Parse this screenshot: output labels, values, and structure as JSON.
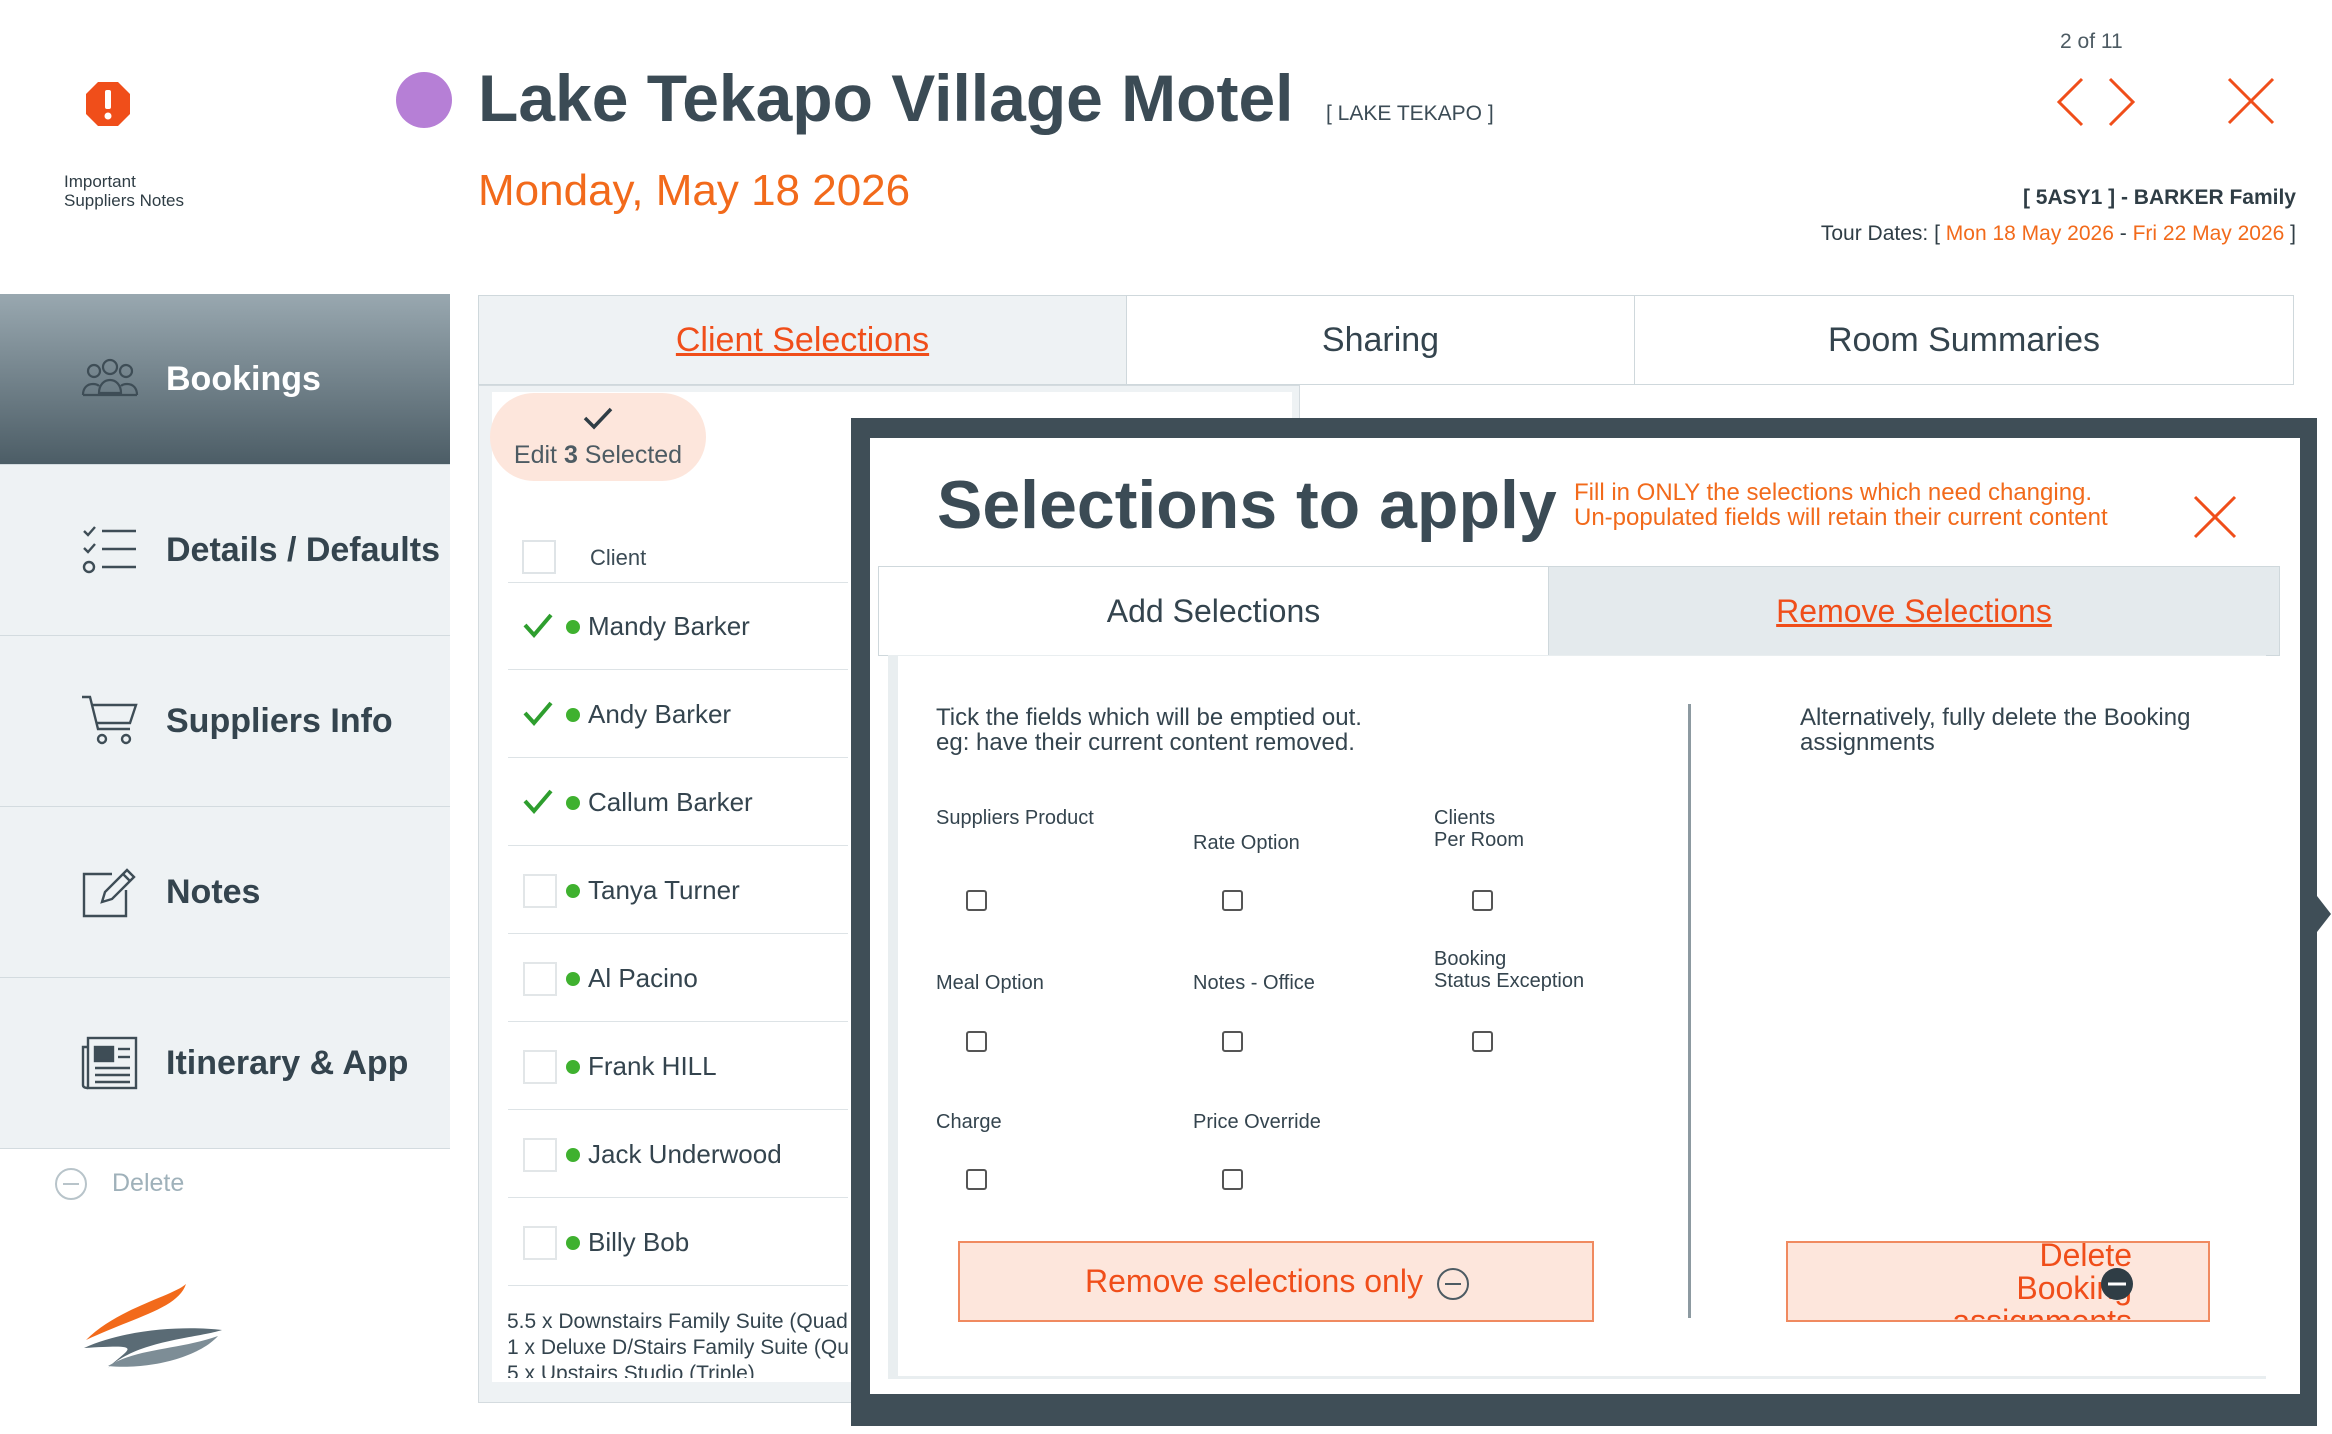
{
  "header": {
    "important_notes_label_line1": "Important",
    "important_notes_label_line2": "Suppliers Notes",
    "title": "Lake Tekapo Village Motel",
    "region": "[ LAKE TEKAPO ]",
    "date": "Monday, May 18 2026",
    "pager": "2 of 11",
    "booking_ref": "[ 5ASY1 ] - BARKER Family",
    "tour_dates_label": "Tour Dates: [",
    "tour_start": "Mon 18 May 2026",
    "tour_sep": "-",
    "tour_end": "Fri 22 May 2026",
    "tour_close": "]",
    "status_color": "#b67fd6",
    "accent_color": "#f26a1b"
  },
  "sidebar": {
    "items": [
      {
        "label": "Bookings",
        "icon": "people-icon"
      },
      {
        "label": "Details / Defaults",
        "icon": "checklist-icon"
      },
      {
        "label": "Suppliers Info",
        "icon": "cart-icon"
      },
      {
        "label": "Notes",
        "icon": "edit-icon"
      },
      {
        "label": "Itinerary & App",
        "icon": "newspaper-icon"
      }
    ],
    "delete_label": "Delete"
  },
  "tabs": [
    "Client Selections",
    "Sharing",
    "Room Summaries"
  ],
  "list": {
    "edit_label_pre": "Edit ",
    "edit_count": "3",
    "edit_label_post": " Selected",
    "column_client": "Client",
    "clients": [
      {
        "name": "Mandy Barker",
        "selected": true
      },
      {
        "name": "Andy Barker",
        "selected": true
      },
      {
        "name": "Callum Barker",
        "selected": true
      },
      {
        "name": "Tanya Turner",
        "selected": false
      },
      {
        "name": "Al Pacino",
        "selected": false
      },
      {
        "name": "Frank HILL",
        "selected": false
      },
      {
        "name": "Jack Underwood",
        "selected": false
      },
      {
        "name": "Billy Bob",
        "selected": false
      }
    ],
    "summary": [
      "5.5 x Downstairs Family Suite (Quad",
      "1 x Deluxe D/Stairs Family Suite (Qu",
      "5 x Upstairs Studio (Triple)"
    ]
  },
  "modal": {
    "title": "Selections to apply",
    "note_line1": "Fill in ONLY the selections which need changing.",
    "note_line2": "Un-populated fields will retain their current content",
    "tabs": [
      "Add Selections",
      "Remove Selections"
    ],
    "instruction_line1": "Tick the fields which will be emptied out.",
    "instruction_line2": "eg: have their current content removed.",
    "fields": {
      "suppliers_product": "Suppliers Product",
      "rate_option": "Rate Option",
      "clients_per_room_1": "Clients",
      "clients_per_room_2": "Per Room",
      "meal_option": "Meal Option",
      "notes_office": "Notes - Office",
      "booking_status_1": "Booking",
      "booking_status_2": "Status Exception",
      "charge": "Charge",
      "price_override": "Price Override"
    },
    "alt_line1": "Alternatively, fully delete the Booking",
    "alt_line2": "assignments",
    "remove_button": "Remove selections only",
    "delete_button_line1": "Delete",
    "delete_button_line2": "Booking",
    "delete_button_line3": "assignments"
  }
}
